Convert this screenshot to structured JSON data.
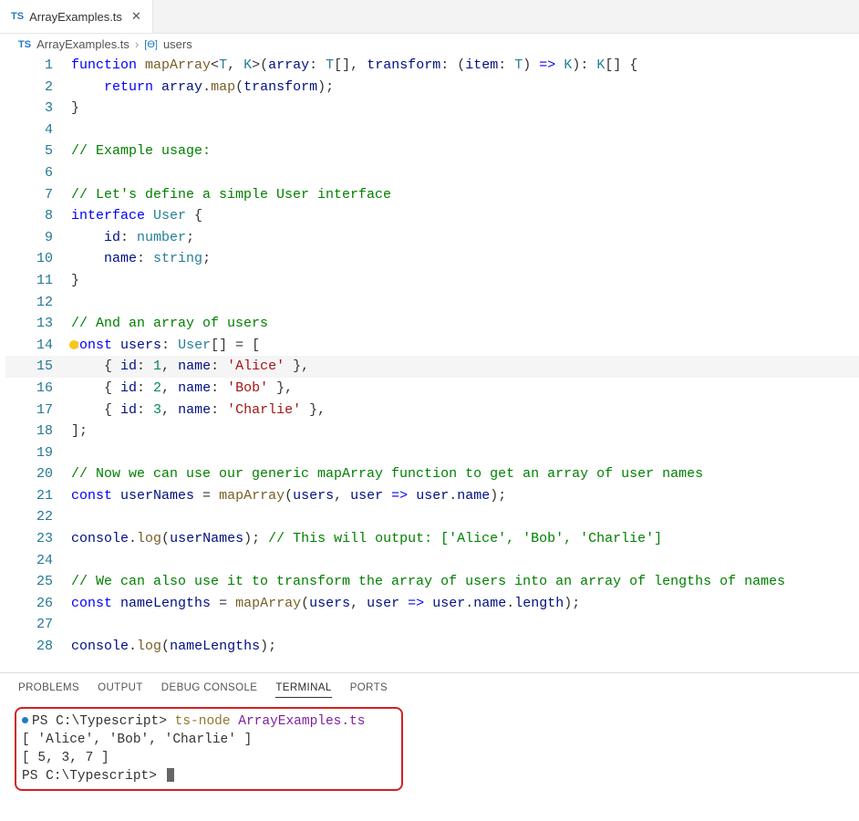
{
  "tab": {
    "icon": "TS",
    "title": "ArrayExamples.ts",
    "close": "✕"
  },
  "breadcrumb": {
    "icon": "TS",
    "file": "ArrayExamples.ts",
    "sep": "›",
    "symIcon": "[ϴ]",
    "symbol": "users"
  },
  "lines": {
    "n1": "1",
    "n2": "2",
    "n3": "3",
    "n4": "4",
    "n5": "5",
    "n6": "6",
    "n7": "7",
    "n8": "8",
    "n9": "9",
    "n10": "10",
    "n11": "11",
    "n12": "12",
    "n13": "13",
    "n14": "14",
    "n15": "15",
    "n16": "16",
    "n17": "17",
    "n18": "18",
    "n19": "19",
    "n20": "20",
    "n21": "21",
    "n22": "22",
    "n23": "23",
    "n24": "24",
    "n25": "25",
    "n26": "26",
    "n27": "27",
    "n28": "28"
  },
  "tok": {
    "function": "function",
    "mapArray": "mapArray",
    "T": "T",
    "K": "K",
    "array": "array",
    "transform": "transform",
    "item": "item",
    "return": "return",
    "map": "map",
    "cmt_usage": "// Example usage:",
    "cmt_user": "// Let's define a simple User interface",
    "interface": "interface",
    "User": "User",
    "id": "id",
    "number": "number",
    "name": "name",
    "string": "string",
    "cmt_arr": "// And an array of users",
    "const": "const",
    "users": "users",
    "n1": "1",
    "n2": "2",
    "n3": "3",
    "s_alice": "'Alice'",
    "s_bob": "'Bob'",
    "s_charlie": "'Charlie'",
    "cmt_now": "// Now we can use our generic mapArray function to get an array of user names",
    "userNames": "userNames",
    "user": "user",
    "console": "console",
    "log": "log",
    "cmt_out": "// This will output: ['Alice', 'Bob', 'Charlie']",
    "cmt_also": "// We can also use it to transform the array of users into an array of lengths of names",
    "nameLengths": "nameLengths",
    "length": "length"
  },
  "panel": {
    "problems": "PROBLEMS",
    "output": "OUTPUT",
    "debug": "DEBUG CONSOLE",
    "terminal": "TERMINAL",
    "ports": "PORTS"
  },
  "terminal": {
    "ps1": "PS C:\\Typescript> ",
    "cmd1a": "ts-node ",
    "cmd1b": "ArrayExamples.ts",
    "out1": "[ 'Alice', 'Bob', 'Charlie' ]",
    "out2": "[ 5, 3, 7 ]",
    "ps2": "PS C:\\Typescript> "
  }
}
